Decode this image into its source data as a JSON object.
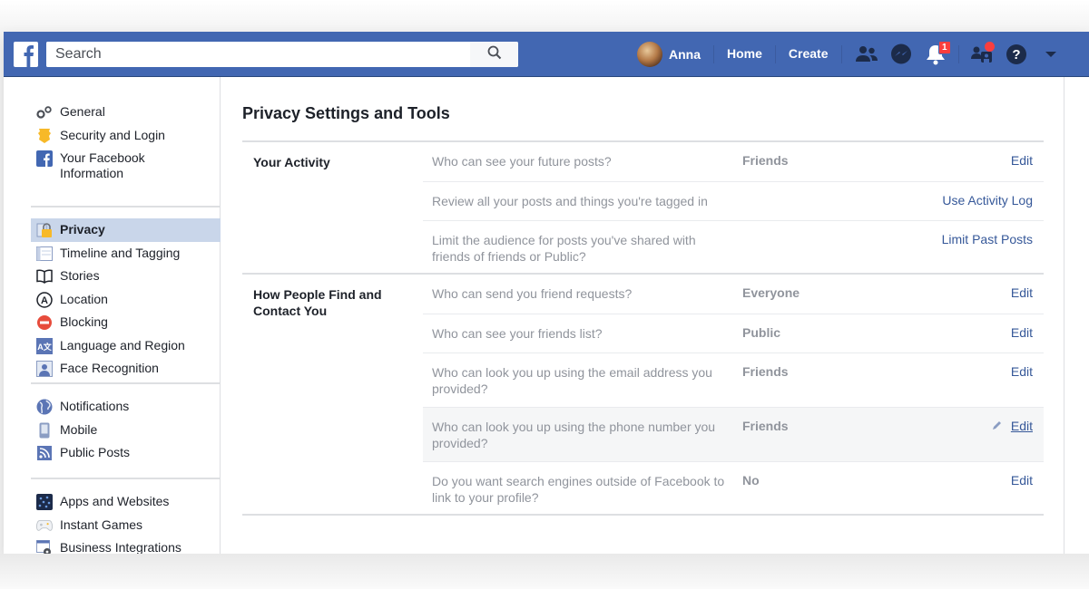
{
  "topbar": {
    "search_placeholder": "Search",
    "user_name": "Anna",
    "nav_links": [
      "Home",
      "Create"
    ],
    "notification_count": "1",
    "brand_color": "#4267b2"
  },
  "sidebar": {
    "groups": [
      [
        {
          "label": "General",
          "icon": "gears-icon"
        },
        {
          "label": "Security and Login",
          "icon": "shield-badge-icon"
        },
        {
          "label": "Your Facebook Information",
          "icon": "facebook-icon"
        }
      ],
      [
        {
          "label": "Privacy",
          "icon": "lock-icon",
          "active": true
        },
        {
          "label": "Timeline and Tagging",
          "icon": "timeline-icon"
        },
        {
          "label": "Stories",
          "icon": "book-icon"
        },
        {
          "label": "Location",
          "icon": "location-icon"
        },
        {
          "label": "Blocking",
          "icon": "block-icon"
        },
        {
          "label": "Language and Region",
          "icon": "language-icon"
        },
        {
          "label": "Face Recognition",
          "icon": "face-recognition-icon"
        }
      ],
      [
        {
          "label": "Notifications",
          "icon": "globe-icon"
        },
        {
          "label": "Mobile",
          "icon": "mobile-icon"
        },
        {
          "label": "Public Posts",
          "icon": "rss-icon"
        }
      ],
      [
        {
          "label": "Apps and Websites",
          "icon": "apps-icon"
        },
        {
          "label": "Instant Games",
          "icon": "gamepad-icon"
        },
        {
          "label": "Business Integrations",
          "icon": "business-gear-icon"
        }
      ]
    ]
  },
  "main": {
    "title": "Privacy Settings and Tools",
    "sections": [
      {
        "title": "Your Activity",
        "rows": [
          {
            "question": "Who can see your future posts?",
            "value": "Friends",
            "action": "Edit"
          },
          {
            "question": "Review all your posts and things you're tagged in",
            "value": "",
            "action": "Use Activity Log"
          },
          {
            "question": "Limit the audience for posts you've shared with friends of friends or Public?",
            "value": "",
            "action": "Limit Past Posts"
          }
        ]
      },
      {
        "title": "How People Find and Contact You",
        "rows": [
          {
            "question": "Who can send you friend requests?",
            "value": "Everyone",
            "action": "Edit"
          },
          {
            "question": "Who can see your friends list?",
            "value": "Public",
            "action": "Edit"
          },
          {
            "question": "Who can look you up using the email address you provided?",
            "value": "Friends",
            "action": "Edit"
          },
          {
            "question": "Who can look you up using the phone number you provided?",
            "value": "Friends",
            "action": "Edit",
            "hovered": true
          },
          {
            "question": "Do you want search engines outside of Facebook to link to your profile?",
            "value": "No",
            "action": "Edit"
          }
        ]
      }
    ]
  }
}
